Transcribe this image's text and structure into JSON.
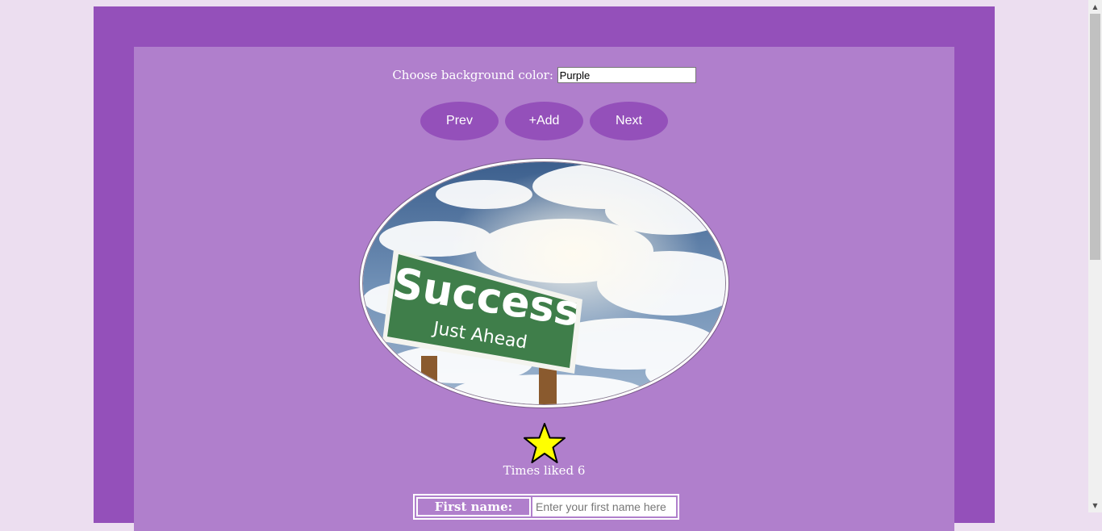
{
  "background_picker": {
    "label": "Choose background color:",
    "value": "Purple"
  },
  "buttons": {
    "prev": "Prev",
    "add": "+Add",
    "next": "Next"
  },
  "image": {
    "sign_main": "Success",
    "sign_sub": "Just Ahead"
  },
  "likes": {
    "text": "Times liked 6"
  },
  "form": {
    "first_name_label": "First name:",
    "first_name_placeholder": "Enter your first name here",
    "first_name_value": ""
  },
  "colors": {
    "page_bg": "#ecdef0",
    "frame": "#9450ba",
    "panel": "#b07fcc",
    "star": "#ffff00"
  },
  "icons": {
    "like": "star-icon",
    "scroll_up": "scroll-up-arrow-icon",
    "scroll_down": "scroll-down-arrow-icon"
  }
}
